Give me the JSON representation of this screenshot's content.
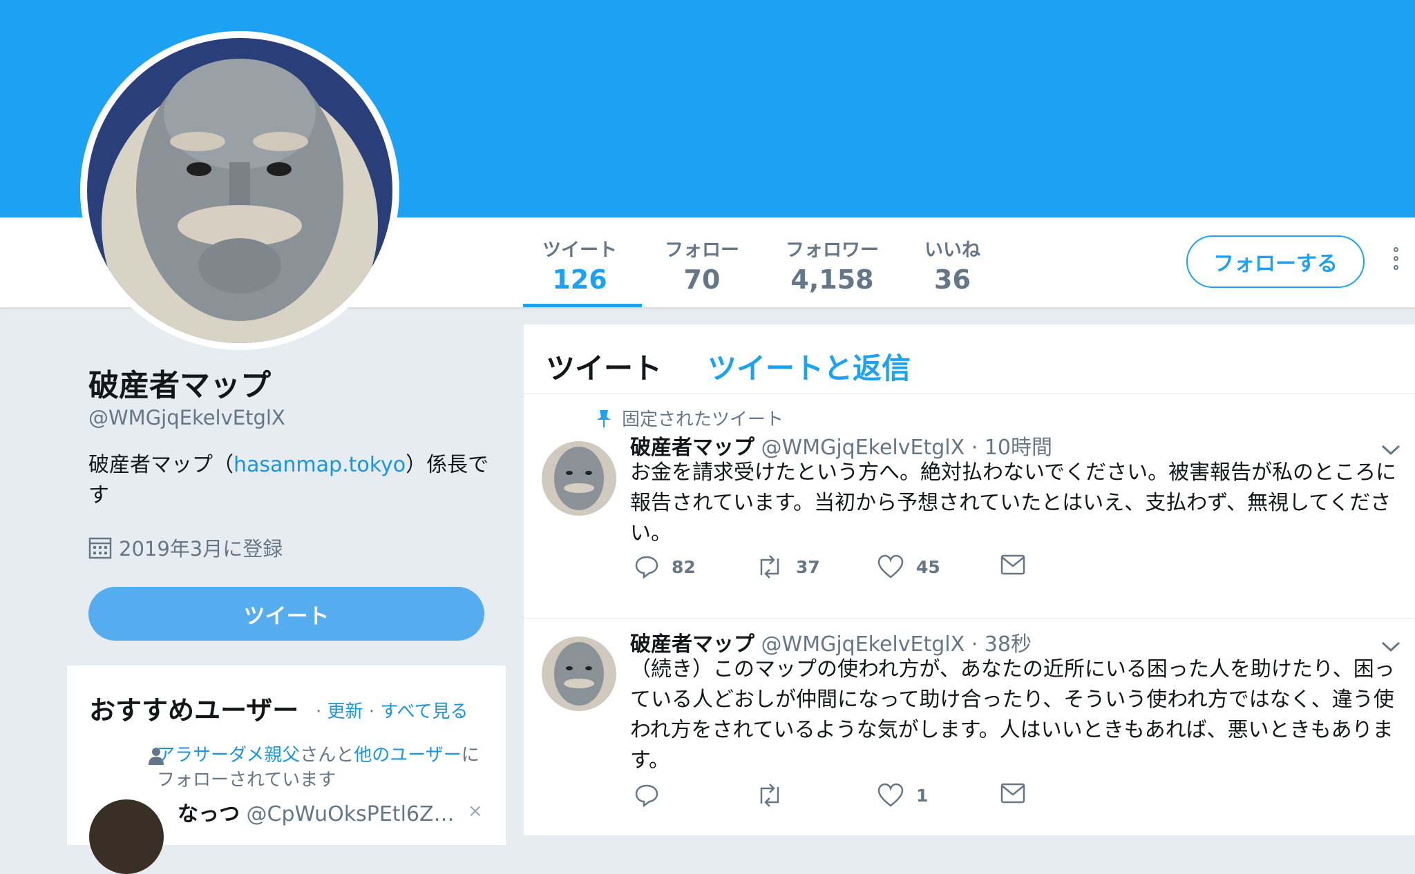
{
  "profile": {
    "name": "破産者マップ",
    "handle": "@WMGjqEkelvEtglX",
    "bio_prefix": "破産者マップ（",
    "bio_link": "hasanmap.tokyo",
    "bio_suffix": "）係長です",
    "joined": "2019年3月に登録",
    "tweet_button": "ツイート"
  },
  "stats": [
    {
      "label": "ツイート",
      "value": "126"
    },
    {
      "label": "フォロー",
      "value": "70"
    },
    {
      "label": "フォロワー",
      "value": "4,158"
    },
    {
      "label": "いいね",
      "value": "36"
    }
  ],
  "follow_button": "フォローする",
  "timeline_tabs": [
    "ツイート",
    "ツイートと返信"
  ],
  "recommend": {
    "title": "おすすめユーザー",
    "sep1": " · ",
    "refresh": "更新",
    "sep2": " · ",
    "view_all": "すべて見る",
    "context_link1": "アラサーダメ親父",
    "context_mid": "さんと",
    "context_link2": "他のユーザー",
    "context_end": "にフォローされています",
    "user_name": "なっつ",
    "user_handle": "@CpWuOksPEtl6Z…",
    "close": "×"
  },
  "tweets": [
    {
      "pinned_label": "固定されたツイート",
      "name": "破産者マップ",
      "handle": "@WMGjqEkelvEtglX",
      "time": " · 10時間",
      "text": "お金を請求受けたという方へ。絶対払わないでください。被害報告が私のところに報告されています。当初から予想されていたとはいえ、支払わず、無視してください。",
      "replies": "82",
      "retweets": "37",
      "likes": "45"
    },
    {
      "name": "破産者マップ",
      "handle": "@WMGjqEkelvEtglX",
      "time": " · 38秒",
      "text": "（続き）このマップの使われ方が、あなたの近所にいる困った人を助けたり、困っている人どおしが仲間になって助け合ったり、そういう使われ方ではなく、違う使われ方をされているような気がします。人はいいときもあれば、悪いときもあります。",
      "replies": "",
      "retweets": "",
      "likes": "1"
    }
  ],
  "colors": {
    "accent": "#1da1f2",
    "banner": "#1da1f2",
    "background": "#e6ecf0"
  }
}
